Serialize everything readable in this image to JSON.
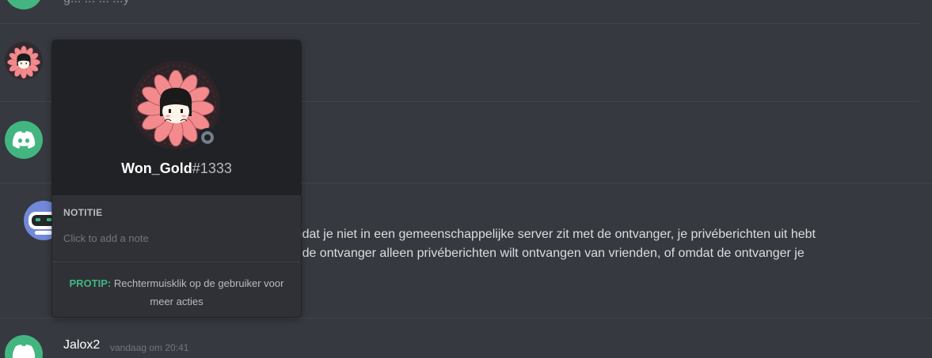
{
  "chat": {
    "top_partial_text": "g... ... ... ...y",
    "message_body_line1": "d omdat je niet in een gemeenschappelijke server zit met de ontvanger, je privéberichten uit hebt",
    "message_body_line2": "rver, de ontvanger alleen privéberichten wilt ontvangen van vrienden, of omdat de ontvanger je",
    "last_message": {
      "username": "Jalox2",
      "timestamp": "vandaag om 20:41"
    }
  },
  "popout": {
    "username": "Won_Gold",
    "discriminator": "#1333",
    "status": "offline",
    "note_label": "NOTITIE",
    "note_placeholder": "Click to add a note",
    "protip_label": "PROTIP:",
    "protip_text": "Rechtermuisklik op de gebruiker voor meer acties"
  },
  "colors": {
    "background": "#36393f",
    "popout_header": "#202225",
    "popout_body": "#2f3136",
    "discord_green": "#43b581",
    "blurple": "#7289da",
    "status_offline": "#747f8d"
  }
}
